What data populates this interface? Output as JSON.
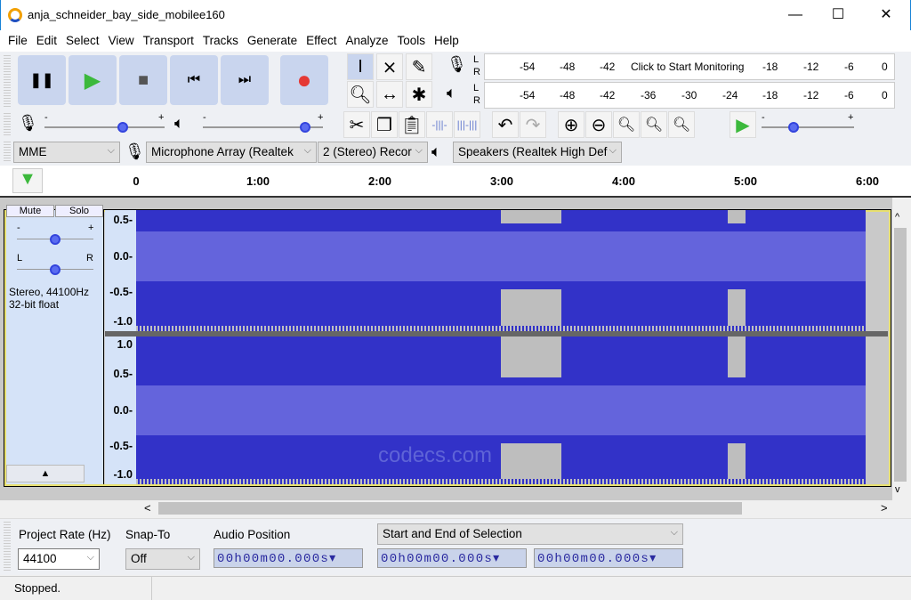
{
  "window": {
    "title": "anja_schneider_bay_side_mobilee160",
    "minimize": "—",
    "maximize": "☐",
    "close": "✕"
  },
  "menu": [
    "File",
    "Edit",
    "Select",
    "View",
    "Transport",
    "Tracks",
    "Generate",
    "Effect",
    "Analyze",
    "Tools",
    "Help"
  ],
  "transport": {
    "pause": "❚❚",
    "play": "▶",
    "stop": "■",
    "skip_start": "⏮",
    "skip_end": "⏭",
    "record": "●"
  },
  "colors": {
    "play": "#3cb93c",
    "record": "#e53935",
    "waveform": "#3232c8",
    "rms": "#6464dc",
    "track_border": "#e8e070"
  },
  "meters": {
    "record": {
      "L": "L",
      "R": "R",
      "prompt": "Click to Start Monitoring",
      "ticks": [
        "-54",
        "-48",
        "-42",
        "-18",
        "-12",
        "-6",
        "0"
      ]
    },
    "playback": {
      "L": "L",
      "R": "R",
      "ticks": [
        "-54",
        "-48",
        "-42",
        "-36",
        "-30",
        "-24",
        "-18",
        "-12",
        "-6",
        "0"
      ]
    }
  },
  "mixer": {
    "minus": "-",
    "plus": "+",
    "record_volume": 0.65,
    "playback_volume": 0.85
  },
  "play_at_speed": {
    "minus": "-",
    "plus": "+",
    "speed": 0.35
  },
  "devices": {
    "host": "MME",
    "input": "Microphone Array (Realtek",
    "channels": "2 (Stereo) Recor",
    "output": "Speakers (Realtek High Def"
  },
  "timeline": {
    "ticks": [
      "0",
      "1:00",
      "2:00",
      "3:00",
      "4:00",
      "5:00",
      "6:00"
    ]
  },
  "track": {
    "mute": "Mute",
    "solo": "Solo",
    "gain_minus": "-",
    "gain_plus": "+",
    "pan_l": "L",
    "pan_r": "R",
    "info1": "Stereo, 44100Hz",
    "info2": "32-bit float",
    "gain": 0.5,
    "pan": 0.5,
    "collapse": "▲",
    "ch1_labels": [
      "0.5-",
      "0.0-",
      "-0.5-",
      "-1.0"
    ],
    "ch2_labels": [
      "1.0",
      "0.5-",
      "0.0-",
      "-0.5-",
      "-1.0"
    ]
  },
  "watermark": "codecs.com",
  "scroll": {
    "left": "<",
    "right": ">",
    "up": "^",
    "down": "v"
  },
  "selection": {
    "rate_label": "Project Rate (Hz)",
    "rate": "44100",
    "snap_label": "Snap-To",
    "snap": "Off",
    "pos_label": "Audio Position",
    "pos": "00h00m00.000s",
    "sel_mode": "Start and End of Selection",
    "start": "00h00m00.000s",
    "end": "00h00m00.000s"
  },
  "status": "Stopped."
}
